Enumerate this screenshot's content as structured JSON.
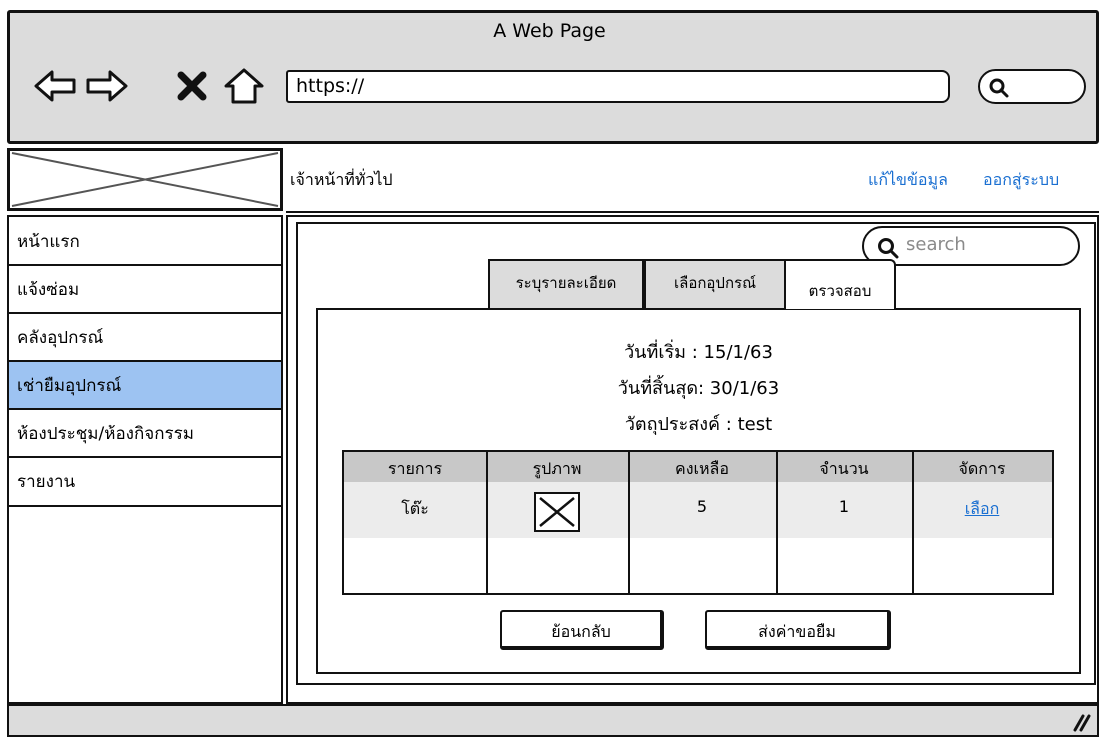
{
  "window": {
    "title": "A Web Page"
  },
  "browser": {
    "url": "https://",
    "nav_icons": [
      "back-arrow-icon",
      "forward-arrow-icon",
      "close-x-icon",
      "home-icon"
    ]
  },
  "header": {
    "user_role": "เจ้าหน้าที่ทั่วไป",
    "edit_label": "แก้ไขข้อมูล",
    "logout_label": "ออกสู่ระบบ",
    "link_color": "#1a6fd1"
  },
  "sidebar": {
    "active_color": "#9dc3f2",
    "items": [
      {
        "label": "หน้าแรก",
        "active": false
      },
      {
        "label": "แจ้งซ่อม",
        "active": false
      },
      {
        "label": "คลังอุปกรณ์",
        "active": false
      },
      {
        "label": "เช่ายืมอุปกรณ์",
        "active": true
      },
      {
        "label": "ห้องประชุม/ห้องกิจกรรม",
        "active": false
      },
      {
        "label": "รายงาน",
        "active": false
      }
    ]
  },
  "search": {
    "placeholder": "search"
  },
  "tabs": [
    {
      "label": "ระบุรายละเอียด",
      "active": false
    },
    {
      "label": "เลือกอุปกรณ์",
      "active": false
    },
    {
      "label": "ตรวจสอบ",
      "active": true
    }
  ],
  "summary": {
    "start": "วันที่เริ่ม : 15/1/63",
    "end": "วันที่สิ้นสุด: 30/1/63",
    "purpose": "วัตถุประสงค์ : test"
  },
  "table": {
    "headers": [
      "รายการ",
      "รูปภาพ",
      "คงเหลือ",
      "จำนวน",
      "จัดการ"
    ],
    "rows": [
      {
        "item": "โต๊ะ",
        "image": "image-placeholder-icon",
        "remaining": "5",
        "quantity": "1",
        "action": "เลือก"
      }
    ]
  },
  "buttons": {
    "back": "ย้อนกลับ",
    "submit": "ส่งค่าขอยืม"
  }
}
